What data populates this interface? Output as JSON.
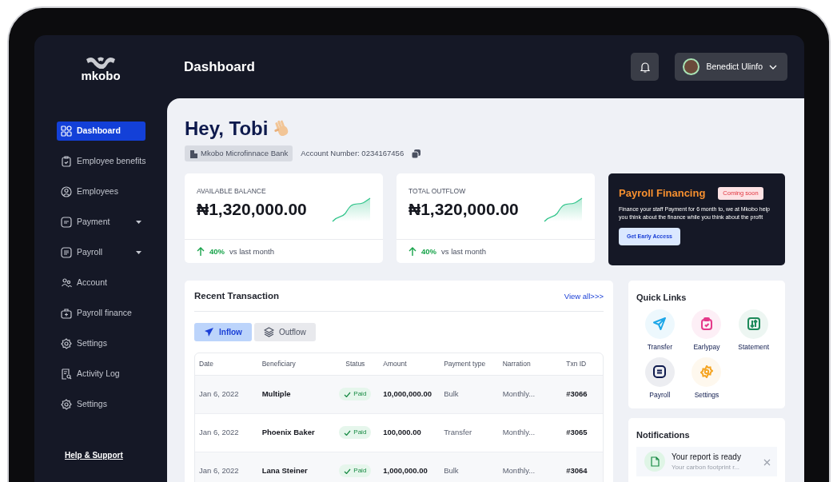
{
  "sidebar": {
    "logo": "mkobo",
    "items": [
      {
        "label": "Dashboard",
        "selected": true,
        "expandable": false
      },
      {
        "label": "Employee benefits",
        "selected": false,
        "expandable": false
      },
      {
        "label": "Employees",
        "selected": false,
        "expandable": false
      },
      {
        "label": "Payment",
        "selected": false,
        "expandable": true
      },
      {
        "label": "Payroll",
        "selected": false,
        "expandable": true
      },
      {
        "label": "Account",
        "selected": false,
        "expandable": false
      },
      {
        "label": "Payroll finance",
        "selected": false,
        "expandable": false
      },
      {
        "label": "Settings",
        "selected": false,
        "expandable": false
      },
      {
        "label": "Activity Log",
        "selected": false,
        "expandable": false
      },
      {
        "label": "Settings",
        "selected": false,
        "expandable": false
      }
    ],
    "help": "Help & Support"
  },
  "header": {
    "title": "Dashboard",
    "user": "Benedict Ulinfo"
  },
  "greeting": "Hey, Tobi",
  "bank": {
    "name": "Mkobo Microfinnace Bank",
    "account": "Account Number: 0234167456"
  },
  "stats": [
    {
      "label": "AVAILABLE BALANCE",
      "value": "₦1,320,000.00",
      "change": "40%",
      "compare": "vs last month"
    },
    {
      "label": "TOTAL OUTFLOW",
      "value": "₦1,320,000.00",
      "change": "40%",
      "compare": "vs last month"
    }
  ],
  "promo": {
    "title": "Payroll Financing",
    "badge": "Coming soon",
    "text": "Finance your staff Payment for 6 month to, we at Mkobo help you think about the finance while you think about the profit",
    "button": "Get Early Access"
  },
  "transactions": {
    "title": "Recent Transaction",
    "view_all": "View all>>>",
    "tabs": [
      {
        "label": "Inflow",
        "selected": true
      },
      {
        "label": "Outflow",
        "selected": false
      }
    ],
    "columns": [
      "Date",
      "Beneficiary",
      "Status",
      "Amount",
      "Payment type",
      "Narration",
      "Txn ID"
    ],
    "rows": [
      {
        "date": "Jan 6, 2022",
        "beneficiary": "Multiple",
        "status": "Paid",
        "amount": "10,000,000.00",
        "payment_type": "Bulk",
        "narration": "Monthly...",
        "txn_id": "#3066"
      },
      {
        "date": "Jan 6, 2022",
        "beneficiary": "Phoenix Baker",
        "status": "Paid",
        "amount": "100,000.00",
        "payment_type": "Transfer",
        "narration": "Monthly...",
        "txn_id": "#3065"
      },
      {
        "date": "Jan 6, 2022",
        "beneficiary": "Lana Steiner",
        "status": "Paid",
        "amount": "1,000,000.00",
        "payment_type": "Bulk",
        "narration": "Monthly...",
        "txn_id": "#3064"
      }
    ]
  },
  "quick_links": {
    "title": "Quick Links",
    "items": [
      {
        "label": "Transfer",
        "color": "#1ea7e8"
      },
      {
        "label": "Earlypay",
        "color": "#e5398a"
      },
      {
        "label": "Statement",
        "color": "#1d8a5a"
      },
      {
        "label": "Payroll",
        "color": "#0e1a4d"
      },
      {
        "label": "Settings",
        "color": "#f5a524"
      }
    ]
  },
  "notifications": {
    "title": "Notifications",
    "items": [
      {
        "title": "Your report is ready",
        "text": "Your carbon footprint r..."
      }
    ]
  }
}
